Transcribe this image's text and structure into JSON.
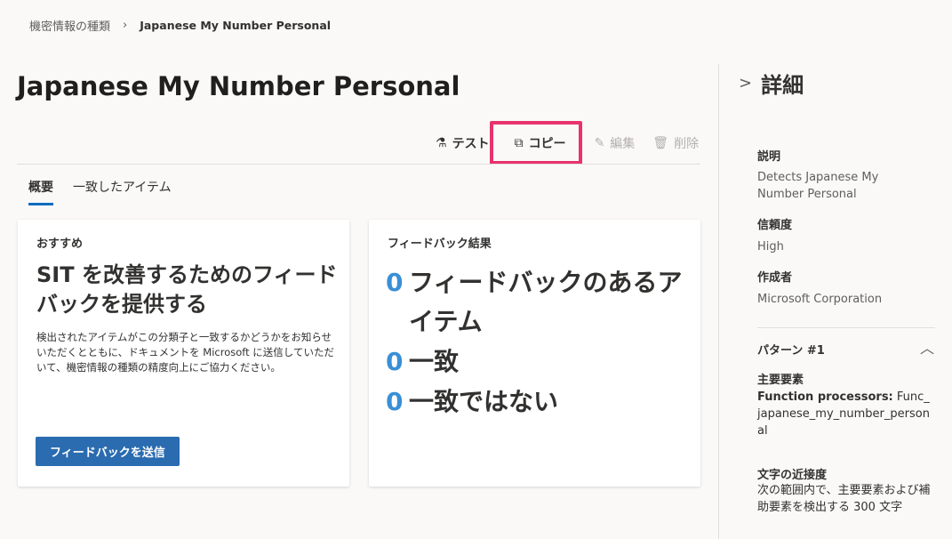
{
  "breadcrumb": {
    "parent": "機密情報の種類",
    "current": "Japanese My Number Personal"
  },
  "title": "Japanese My Number Personal",
  "toolbar": {
    "test": "テスト",
    "copy": "コピー",
    "edit": "編集",
    "delete": "削除"
  },
  "tabs": [
    "概要",
    "一致したアイテム"
  ],
  "recommend": {
    "header": "おすすめ",
    "title": "SIT を改善するためのフィードバックを提供する",
    "desc": "検出されたアイテムがこの分類子と一致するかどうかをお知らせいただくとともに、ドキュメントを Microsoft に送信していただいて、機密情報の種類の精度向上にご協力ください。",
    "button": "フィードバックを送信"
  },
  "feedback": {
    "header": "フィードバック結果",
    "rows": [
      {
        "count": "0",
        "label": "フィードバックのあるアイテム"
      },
      {
        "count": "0",
        "label": "一致"
      },
      {
        "count": "0",
        "label": "一致ではない"
      }
    ]
  },
  "details": {
    "title": "詳細",
    "desc_label": "説明",
    "desc": "Detects Japanese My Number Personal",
    "conf_label": "信頼度",
    "conf": "High",
    "pub_label": "作成者",
    "pub": "Microsoft Corporation",
    "pattern": "パターン #1",
    "primary_label": "主要要素",
    "primary_key": "Function processors:",
    "primary_val": "Func_japanese_my_number_personal",
    "prox_label": "文字の近接度",
    "prox": "次の範囲内で、主要要素および補助要素を検出する 300 文字"
  }
}
